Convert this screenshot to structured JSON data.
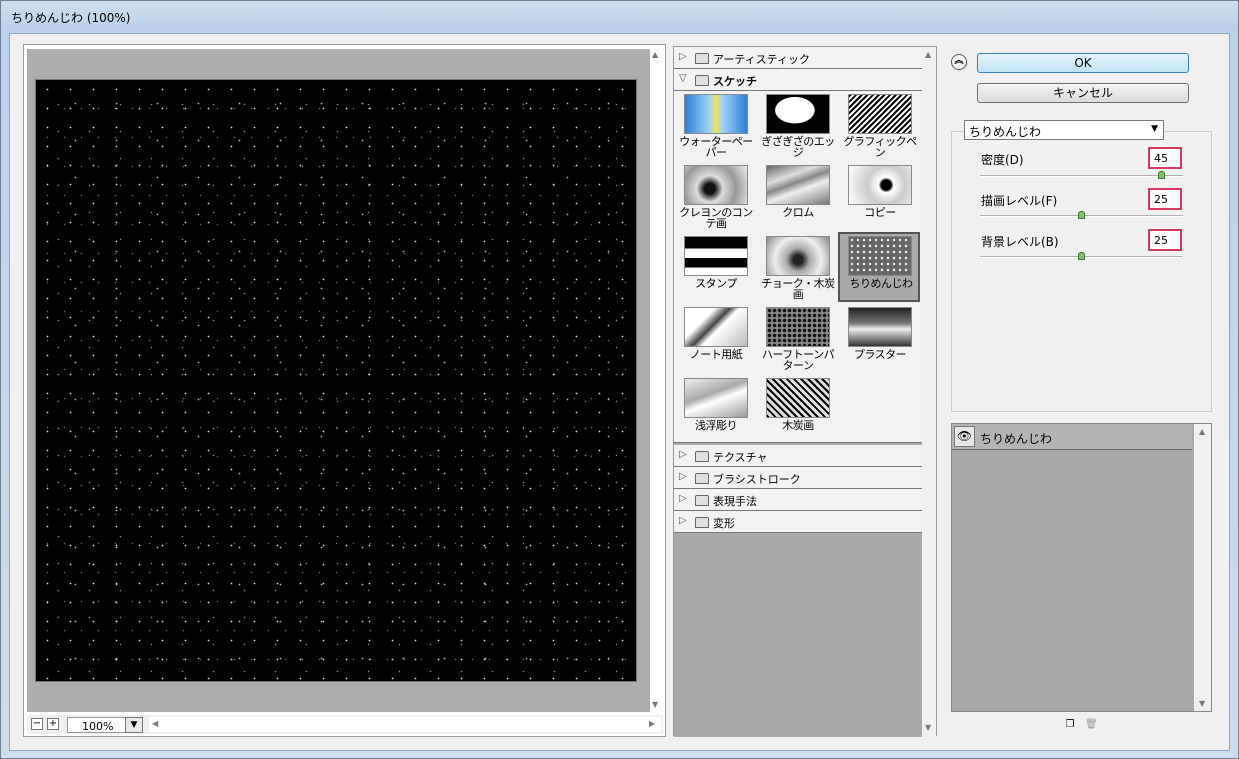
{
  "window": {
    "title": "ちりめんじわ (100%)"
  },
  "preview": {
    "zoom": "100%",
    "zoom_out": "−",
    "zoom_in": "+"
  },
  "gallery": {
    "categories_top": [
      {
        "label": "アーティスティック",
        "expanded": false
      }
    ],
    "open_category": {
      "label": "スケッチ",
      "expanded": true
    },
    "thumbnails": [
      {
        "label": "ウォーターペーパー",
        "selected": false
      },
      {
        "label": "ぎざぎざのエッジ",
        "selected": false
      },
      {
        "label": "グラフィックペン",
        "selected": false
      },
      {
        "label": "クレヨンのコンテ画",
        "selected": false
      },
      {
        "label": "クロム",
        "selected": false
      },
      {
        "label": "コピー",
        "selected": false
      },
      {
        "label": "スタンプ",
        "selected": false
      },
      {
        "label": "チョーク・木炭画",
        "selected": false
      },
      {
        "label": "ちりめんじわ",
        "selected": true
      },
      {
        "label": "ノート用紙",
        "selected": false
      },
      {
        "label": "ハーフトーンパターン",
        "selected": false
      },
      {
        "label": "プラスター",
        "selected": false
      },
      {
        "label": "浅浮彫り",
        "selected": false
      },
      {
        "label": "木炭画",
        "selected": false
      }
    ],
    "categories_bottom": [
      {
        "label": "テクスチャ"
      },
      {
        "label": "ブラシストローク"
      },
      {
        "label": "表現手法"
      },
      {
        "label": "変形"
      }
    ]
  },
  "buttons": {
    "ok": "OK",
    "cancel": "キャンセル"
  },
  "filter_select": {
    "value": "ちりめんじわ"
  },
  "params": [
    {
      "label": "密度(D)",
      "value": "45",
      "level": 0.9
    },
    {
      "label": "描画レベル(F)",
      "value": "25",
      "level": 0.5
    },
    {
      "label": "背景レベル(B)",
      "value": "25",
      "level": 0.5
    }
  ],
  "layers": [
    {
      "name": "ちりめんじわ",
      "visible": true
    }
  ],
  "colors": {
    "highlight_border": "#d6395f",
    "ok_button": "#c0e4f6",
    "slider_knob": "#7fc26e"
  }
}
